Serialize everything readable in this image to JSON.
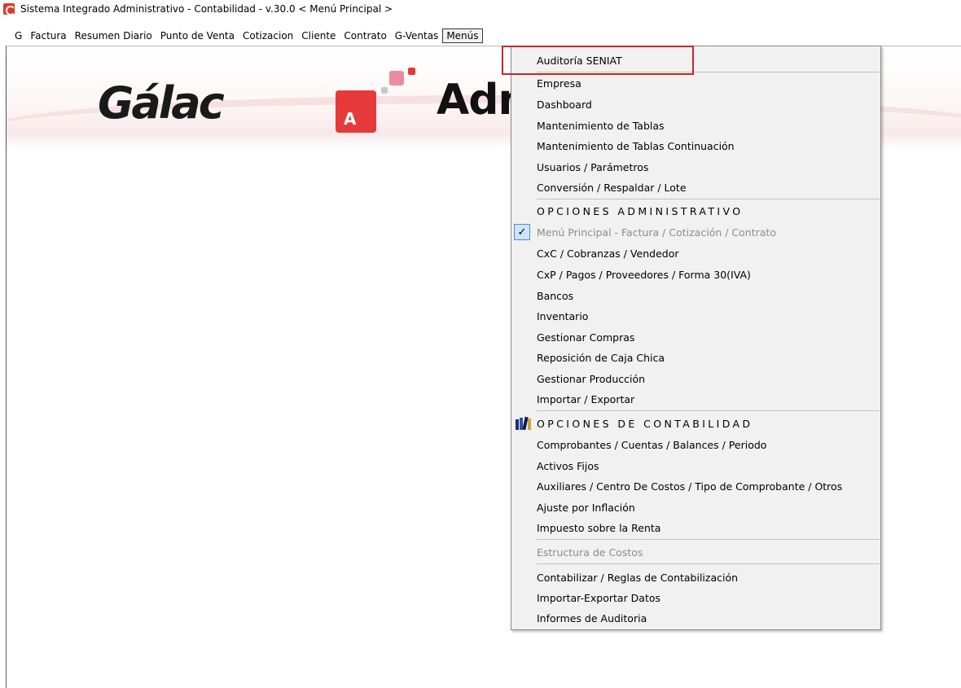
{
  "window": {
    "title": "Sistema Integrado Administrativo - Contabilidad - v.30.0 < Menú Principal >",
    "icon": "galac-app-icon"
  },
  "menubar": {
    "items": [
      "G",
      "Factura",
      "Resumen Diario",
      "Punto de Venta",
      "Cotizacion",
      "Cliente",
      "Contrato",
      "G-Ventas",
      "Menús"
    ],
    "active": "Menús"
  },
  "banner": {
    "galac_logo": "Gálac",
    "admin_logo_letter": "A",
    "admin_logo_text": "Adm"
  },
  "dropdown": {
    "items": [
      {
        "label": "Auditoría SENIAT",
        "highlighted": true
      },
      {
        "label": "Empresa"
      },
      {
        "label": "Dashboard"
      },
      {
        "label": "Mantenimiento de Tablas"
      },
      {
        "label": "Mantenimiento de Tablas Continuación"
      },
      {
        "label": "Usuarios / Parámetros"
      },
      {
        "label": "Conversión / Respaldar / Lote"
      },
      {
        "label": "OPCIONES ADMINISTRATIVO",
        "type": "section"
      },
      {
        "label": "Menú Principal - Factura / Cotización / Contrato",
        "disabled": true,
        "checked": true
      },
      {
        "label": "CxC / Cobranzas / Vendedor"
      },
      {
        "label": "CxP / Pagos / Proveedores / Forma 30(IVA)"
      },
      {
        "label": "Bancos"
      },
      {
        "label": "Inventario"
      },
      {
        "label": "Gestionar Compras"
      },
      {
        "label": "Reposición de Caja Chica"
      },
      {
        "label": "Gestionar Producción"
      },
      {
        "label": "Importar / Exportar"
      },
      {
        "label": "OPCIONES DE CONTABILIDAD",
        "type": "section",
        "icon": "books-icon"
      },
      {
        "label": "Comprobantes / Cuentas / Balances / Periodo"
      },
      {
        "label": "Activos Fijos"
      },
      {
        "label": "Auxiliares / Centro De Costos / Tipo de Comprobante / Otros"
      },
      {
        "label": "Ajuste por Inflación"
      },
      {
        "label": "Impuesto sobre la Renta"
      },
      {
        "label": "Estructura de Costos",
        "disabled": true
      },
      {
        "label": "Contabilizar / Reglas de Contabilización"
      },
      {
        "label": "Importar-Exportar Datos"
      },
      {
        "label": "Informes de Auditoria"
      }
    ]
  },
  "colors": {
    "highlight_border": "#c0282d",
    "brand_red": "#e63a3a",
    "check_bg": "#cde4f7"
  }
}
